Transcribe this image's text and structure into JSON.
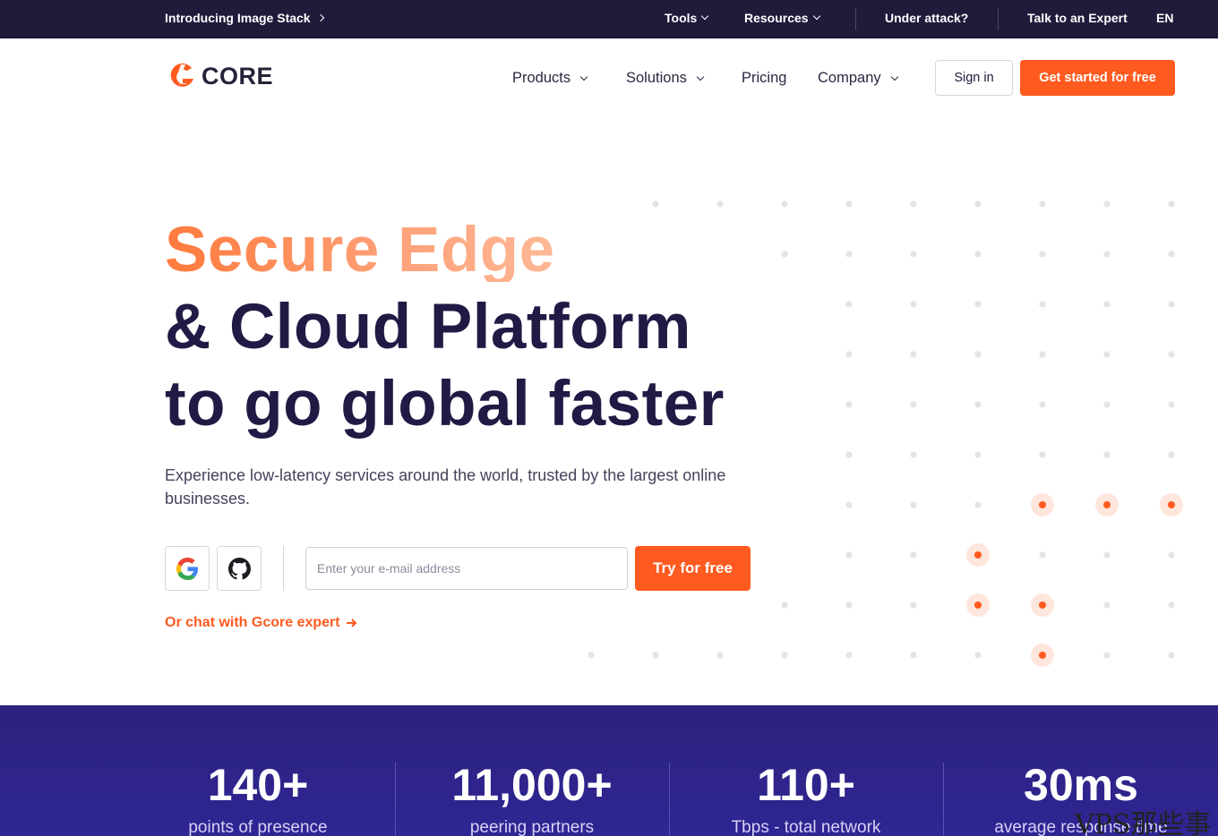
{
  "topbar": {
    "promo": "Introducing Image Stack",
    "tools": "Tools",
    "resources": "Resources",
    "under_attack": "Under attack?",
    "talk_expert": "Talk to an Expert",
    "language": "EN"
  },
  "nav": {
    "logo_text": "CORE",
    "products": "Products",
    "solutions": "Solutions",
    "pricing": "Pricing",
    "company": "Company",
    "sign_in": "Sign in",
    "get_started": "Get started for free"
  },
  "hero": {
    "line1": "Secure Edge",
    "line2": "& Cloud Platform",
    "line3": "to go global faster",
    "subtitle": "Experience low-latency services around the world, trusted by the largest online businesses.",
    "email_placeholder": "Enter your e-mail address",
    "try_button": "Try for free",
    "chat_link": "Or chat with Gcore expert"
  },
  "colors": {
    "accent": "#ff5a1f",
    "dark": "#1f1b3b",
    "stats_bg": "#2c237d"
  },
  "icons": {
    "google": "google-icon",
    "github": "github-icon",
    "arrow": "arrow-right-icon"
  },
  "stats": [
    {
      "value": "140+",
      "label": "points of presence"
    },
    {
      "value": "11,000+",
      "label": "peering partners"
    },
    {
      "value": "110+",
      "label": "Tbps - total network"
    },
    {
      "value": "30ms",
      "label": "average response time"
    }
  ],
  "watermark": "VPS那些事"
}
